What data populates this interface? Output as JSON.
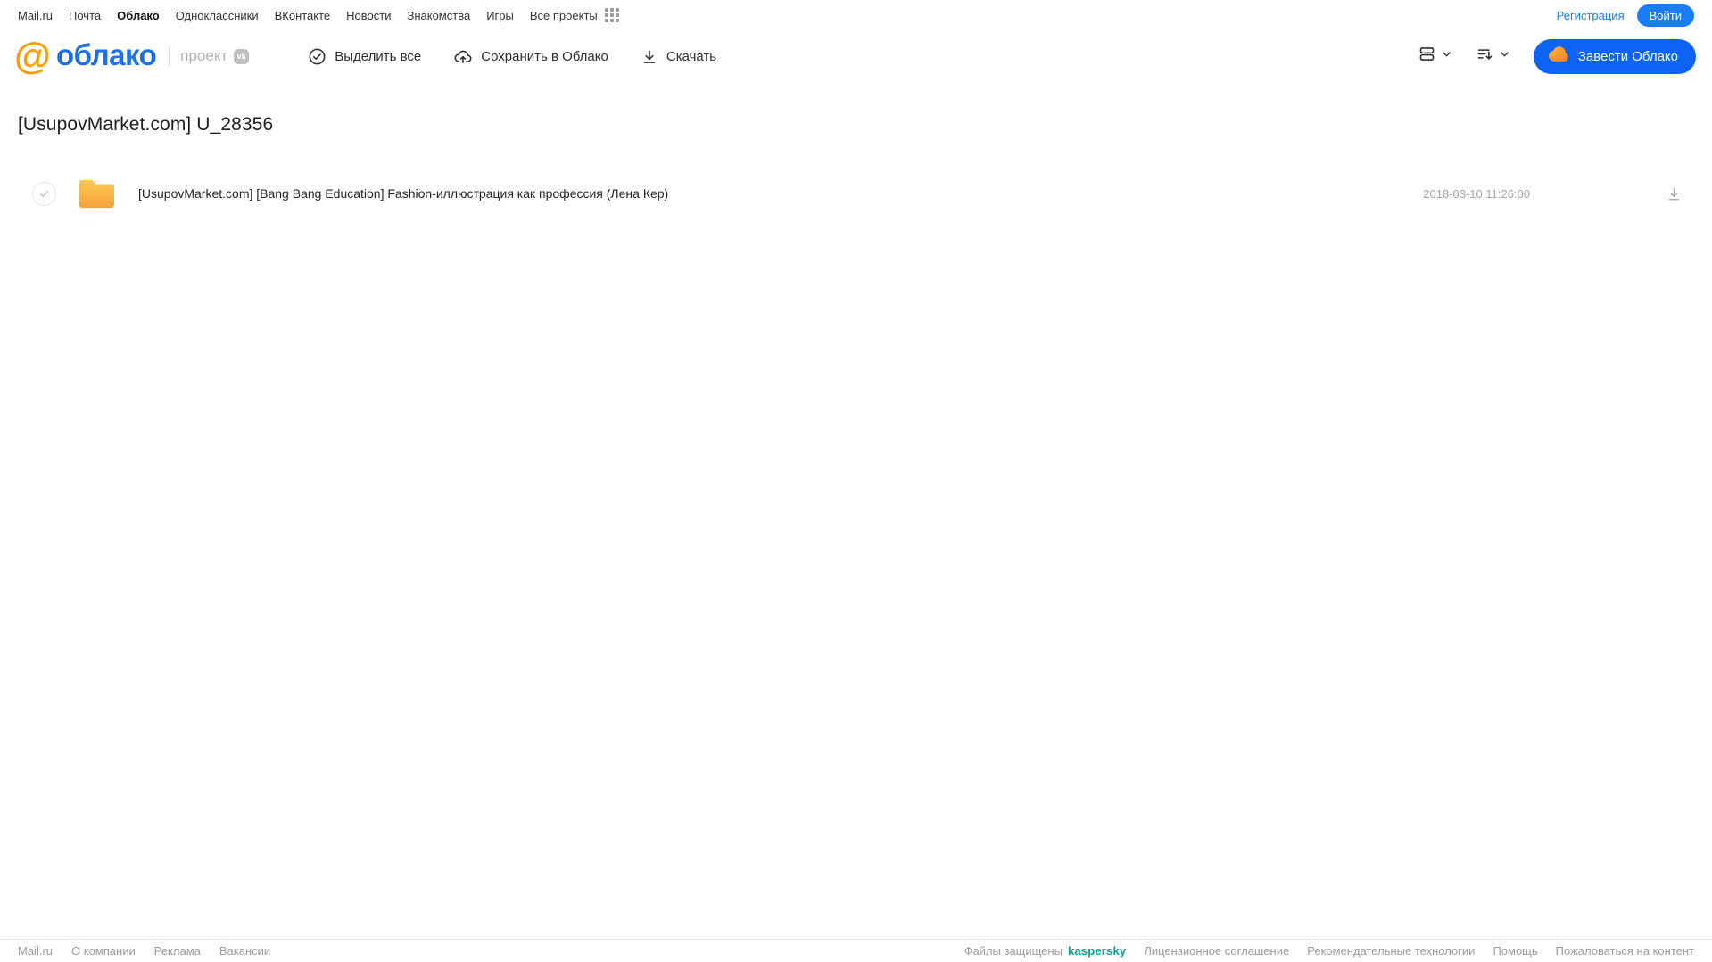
{
  "topnav": {
    "items": [
      {
        "label": "Mail.ru",
        "active": false
      },
      {
        "label": "Почта",
        "active": false
      },
      {
        "label": "Облако",
        "active": true
      },
      {
        "label": "Одноклассники",
        "active": false
      },
      {
        "label": "ВКонтакте",
        "active": false
      },
      {
        "label": "Новости",
        "active": false
      },
      {
        "label": "Знакомства",
        "active": false
      },
      {
        "label": "Игры",
        "active": false
      },
      {
        "label": "Все проекты",
        "active": false
      }
    ],
    "registration_label": "Регистрация",
    "login_label": "Войти"
  },
  "header": {
    "logo_at": "@",
    "logo_text": "облако",
    "project_label": "проект",
    "vk_badge_label": "vk",
    "toolbar": {
      "select_all_label": "Выделить все",
      "save_to_cloud_label": "Сохранить в Облако",
      "download_label": "Скачать"
    },
    "get_cloud_label": "Завести Облако"
  },
  "main": {
    "title": "[UsupovMarket.com] U_28356",
    "files": [
      {
        "type": "folder",
        "name": "[UsupovMarket.com] [Bang Bang Education] Fashion-иллюстрация как профессия (Лена Кер)",
        "modified": "2018-03-10 11:26:00"
      }
    ]
  },
  "footer": {
    "left_links": [
      "Mail.ru",
      "О компании",
      "Реклама",
      "Вакансии"
    ],
    "protected_label": "Файлы защищены",
    "kaspersky_label": "kaspersky",
    "right_links": [
      "Лицензионное соглашение",
      "Рекомендательные технологии",
      "Помощь",
      "Пожаловаться на контент"
    ]
  },
  "colors": {
    "accent_blue": "#0d63f3",
    "link_blue": "#1b7cf7",
    "logo_blue": "#1f6fe5",
    "logo_orange": "#ff9e00",
    "folder_yellow_top": "#ffc850",
    "folder_yellow_bottom": "#f2a33c",
    "kaspersky_green": "#00a88e"
  }
}
